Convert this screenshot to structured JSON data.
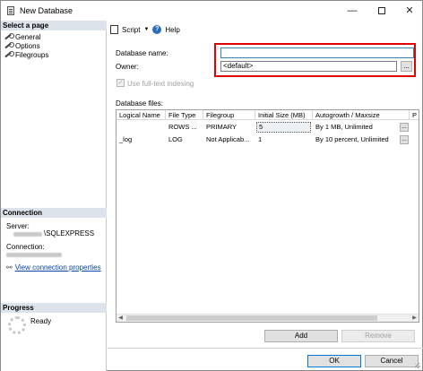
{
  "window": {
    "title": "New Database",
    "min_glyph": "—",
    "close_glyph": "✕"
  },
  "left": {
    "select_page_header": "Select a page",
    "pages": [
      {
        "label": "General",
        "icon": "wrench-icon"
      },
      {
        "label": "Options",
        "icon": "wrench-icon"
      },
      {
        "label": "Filegroups",
        "icon": "wrench-icon"
      }
    ],
    "connection_header": "Connection",
    "server_label": "Server:",
    "server_value": "\\SQLEXPRESS",
    "connection_label": "Connection:",
    "view_props_link": "View connection properties",
    "progress_header": "Progress",
    "progress_status": "Ready"
  },
  "toolbar": {
    "script_label": "Script",
    "dropdown_glyph": "▼",
    "help_glyph": "?",
    "help_label": "Help"
  },
  "form": {
    "db_name_label": "Database name:",
    "db_name_value": "",
    "owner_label": "Owner:",
    "owner_value": "<default>",
    "ellipsis": "...",
    "checkmark": "✓",
    "fulltext_label": "Use full-text indexing",
    "files_label": "Database files:"
  },
  "grid": {
    "columns": [
      "Logical Name",
      "File Type",
      "Filegroup",
      "Initial Size (MB)",
      "Autogrowth / Maxsize",
      "P"
    ],
    "rows": [
      {
        "logical_name": "",
        "file_type": "ROWS ...",
        "filegroup": "PRIMARY",
        "initial_size": "5",
        "autogrowth": "By 1 MB, Unlimited"
      },
      {
        "logical_name": "_log",
        "file_type": "LOG",
        "filegroup": "Not Applicab...",
        "initial_size": "1",
        "autogrowth": "By 10 percent, Unlimited"
      }
    ],
    "cell_button": "...",
    "scroll_left_glyph": "◀",
    "scroll_right_glyph": "▶"
  },
  "buttons": {
    "add": "Add",
    "remove": "Remove",
    "ok": "OK",
    "cancel": "Cancel"
  },
  "colors": {
    "highlight": "#e00000",
    "link": "#0645ad",
    "section_header_bg": "#dde3ea"
  }
}
